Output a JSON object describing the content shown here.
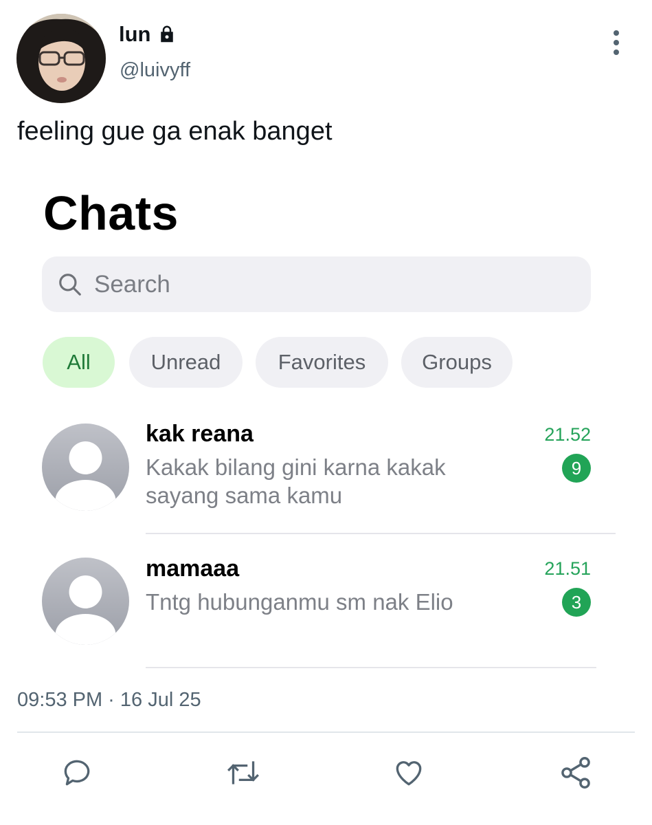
{
  "tweet": {
    "display_name": "lun",
    "handle": "@luivyff",
    "text": "feeling gue ga enak banget",
    "timestamp": "09:53 PM · 16 Jul 25",
    "icons": {
      "protected": "lock-icon",
      "more": "more-vertical-icon"
    }
  },
  "whatsapp": {
    "title": "Chats",
    "search_placeholder": "Search",
    "filters": [
      {
        "label": "All",
        "active": true
      },
      {
        "label": "Unread",
        "active": false
      },
      {
        "label": "Favorites",
        "active": false
      },
      {
        "label": "Groups",
        "active": false
      }
    ],
    "chats": [
      {
        "name": "kak reana",
        "message": "Kakak bilang gini karna kakak sayang sama kamu",
        "time": "21.52",
        "unread": "9"
      },
      {
        "name": "mamaaa",
        "message": "Tntg hubunganmu sm nak Elio",
        "time": "21.51",
        "unread": "3"
      }
    ],
    "colors": {
      "accent_green": "#21a456",
      "active_chip_bg": "#d9f8d4"
    }
  },
  "actions": [
    "reply-icon",
    "retweet-icon",
    "like-icon",
    "share-icon"
  ]
}
